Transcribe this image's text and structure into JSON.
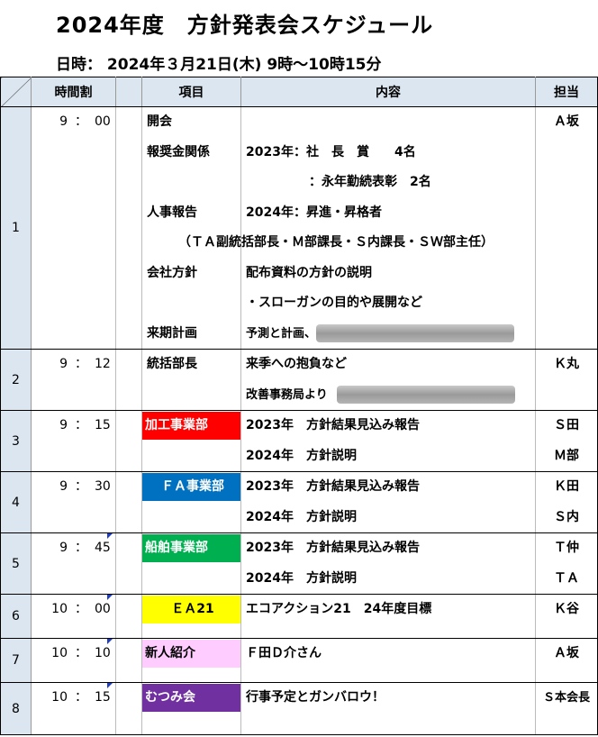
{
  "title": "2024年度　方針発表会スケジュール",
  "date_line": "日時：  2024年３月21日(木)   9時～10時15分",
  "headers": {
    "time": "時間割",
    "item": "項目",
    "content": "内容",
    "resp": "担当"
  },
  "colors": {
    "header_bg": "#dce6f1",
    "red": "#ff0000",
    "blue": "#0070c0",
    "green": "#00b050",
    "yellow": "#ffff00",
    "pink": "#ffccff",
    "purple": "#7030a0",
    "comment_marker": "#1f3fbf"
  },
  "rows": [
    {
      "no": "1",
      "hour": "9",
      "sep": "：",
      "min": "00",
      "lines": [
        {
          "item": "開会",
          "content": "",
          "resp": "Ａ坂"
        },
        {
          "item": "報奨金関係",
          "content": "2023年：社　長　賞　　4名",
          "resp": ""
        },
        {
          "item": "",
          "content": "　　　　　：永年勤続表彰　2名",
          "resp": ""
        },
        {
          "item": "人事報告",
          "content": "2024年：昇進・昇格者",
          "resp": ""
        },
        {
          "item": "",
          "content": "",
          "resp": "",
          "span": "（ＴＡ副統括部長・Ｍ部課長・Ｓ内課長・ＳＷ部主任）"
        },
        {
          "item": "会社方針",
          "content": "配布資料の方針の説明",
          "resp": ""
        },
        {
          "item": "",
          "content": "・スローガンの目的や展開など",
          "resp": ""
        },
        {
          "item": "来期計画",
          "content": "予測と計画、",
          "resp": ""
        }
      ]
    },
    {
      "no": "2",
      "hour": "9",
      "sep": "：",
      "min": "12",
      "lines": [
        {
          "item": "統括部長",
          "content": "来季への抱負など",
          "resp": "Ｋ丸"
        },
        {
          "item": "",
          "content": "改善事務局より",
          "resp": ""
        }
      ]
    },
    {
      "no": "3",
      "hour": "9",
      "sep": "：",
      "min": "15",
      "lines": [
        {
          "item": "加工事業部",
          "content": "2023年　方針結果見込み報告",
          "resp": "Ｓ田"
        },
        {
          "item": "",
          "content": "2024年　方針説明",
          "resp": "Ｍ部"
        }
      ]
    },
    {
      "no": "4",
      "hour": "9",
      "sep": "：",
      "min": "30",
      "lines": [
        {
          "item": "ＦＡ事業部",
          "content": "2023年　方針結果見込み報告",
          "resp": "Ｋ田"
        },
        {
          "item": "",
          "content": "2024年　方針説明",
          "resp": "Ｓ内"
        }
      ]
    },
    {
      "no": "5",
      "hour": "9",
      "sep": "：",
      "min": "45",
      "lines": [
        {
          "item": "船舶事業部",
          "content": "2023年　方針結果見込み報告",
          "resp": "Ｔ仲"
        },
        {
          "item": "",
          "content": "2024年　方針説明",
          "resp": "ＴＡ"
        }
      ]
    },
    {
      "no": "6",
      "hour": "10",
      "sep": "：",
      "min": "00",
      "lines": [
        {
          "item": "ＥＡ21",
          "content": "エコアクション21　24年度目標",
          "resp": "Ｋ谷"
        }
      ]
    },
    {
      "no": "7",
      "hour": "10",
      "sep": "：",
      "min": "10",
      "lines": [
        {
          "item": "新人紹介",
          "content": "Ｆ田Ｄ介さん",
          "resp": "Ａ坂"
        }
      ]
    },
    {
      "no": "8",
      "hour": "10",
      "sep": "：",
      "min": "15",
      "lines": [
        {
          "item": "むつみ会",
          "content": "行事予定とガンバロウ！",
          "resp": "Ｓ本会長"
        }
      ]
    }
  ]
}
